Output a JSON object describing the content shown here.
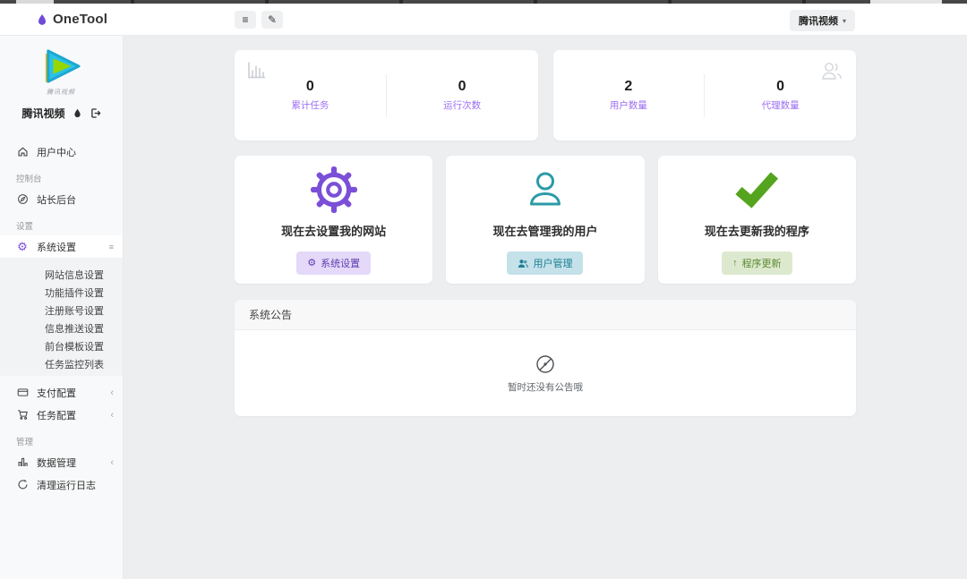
{
  "topbar": {
    "app_name": "OneTool",
    "site_selector": "腾讯视频"
  },
  "icons": {
    "hamburger": "≡",
    "brush": "✎",
    "gear": "⚙",
    "chevron_down": "▾",
    "chevron_left": "‹",
    "up_arrow": "↑",
    "menu_indicator": "≡"
  },
  "sidebar": {
    "logo_caption": "腾讯视频",
    "brand_name": "腾讯视频",
    "item_user_center": "用户中心",
    "section_console": "控制台",
    "item_webmaster": "站长后台",
    "section_settings": "设置",
    "item_system_settings": "系统设置",
    "submenu": [
      "网站信息设置",
      "功能插件设置",
      "注册账号设置",
      "信息推送设置",
      "前台模板设置",
      "任务监控列表"
    ],
    "item_payment": "支付配置",
    "item_task": "任务配置",
    "section_manage": "管理",
    "item_data": "数据管理",
    "item_clear_log": "清理运行日志"
  },
  "stats": {
    "cards": [
      {
        "icon": "bar-chart-icon",
        "items": [
          {
            "value": "0",
            "label": "累计任务"
          },
          {
            "value": "0",
            "label": "运行次数"
          }
        ]
      },
      {
        "icon": "users-icon",
        "items": [
          {
            "value": "2",
            "label": "用户数量"
          },
          {
            "value": "0",
            "label": "代理数量"
          }
        ]
      }
    ]
  },
  "actions": [
    {
      "title": "现在去设置我的网站",
      "button": "系统设置",
      "accent": "#7b4fd8"
    },
    {
      "title": "现在去管理我的用户",
      "button": "用户管理",
      "accent": "#2b9aa8"
    },
    {
      "title": "现在去更新我的程序",
      "button": "程序更新",
      "accent": "#55a41f"
    }
  ],
  "announcement": {
    "title": "系统公告",
    "empty_text": "暂时还没有公告哦"
  },
  "colors": {
    "accent_purple": "#7b4fd8",
    "accent_teal": "#2b9aa8",
    "accent_green": "#55a41f",
    "label_purple": "#9b6ef3"
  }
}
